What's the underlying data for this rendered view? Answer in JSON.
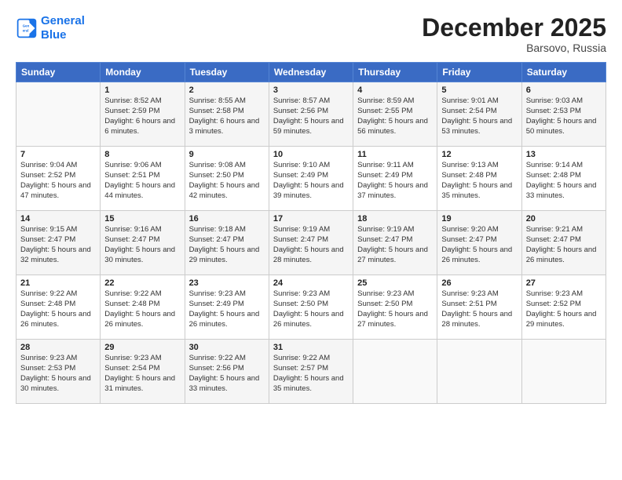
{
  "logo": {
    "line1": "General",
    "line2": "Blue"
  },
  "header": {
    "month": "December 2025",
    "location": "Barsovo, Russia"
  },
  "weekdays": [
    "Sunday",
    "Monday",
    "Tuesday",
    "Wednesday",
    "Thursday",
    "Friday",
    "Saturday"
  ],
  "weeks": [
    [
      {
        "day": "",
        "sunrise": "",
        "sunset": "",
        "daylight": ""
      },
      {
        "day": "1",
        "sunrise": "Sunrise: 8:52 AM",
        "sunset": "Sunset: 2:59 PM",
        "daylight": "Daylight: 6 hours and 6 minutes."
      },
      {
        "day": "2",
        "sunrise": "Sunrise: 8:55 AM",
        "sunset": "Sunset: 2:58 PM",
        "daylight": "Daylight: 6 hours and 3 minutes."
      },
      {
        "day": "3",
        "sunrise": "Sunrise: 8:57 AM",
        "sunset": "Sunset: 2:56 PM",
        "daylight": "Daylight: 5 hours and 59 minutes."
      },
      {
        "day": "4",
        "sunrise": "Sunrise: 8:59 AM",
        "sunset": "Sunset: 2:55 PM",
        "daylight": "Daylight: 5 hours and 56 minutes."
      },
      {
        "day": "5",
        "sunrise": "Sunrise: 9:01 AM",
        "sunset": "Sunset: 2:54 PM",
        "daylight": "Daylight: 5 hours and 53 minutes."
      },
      {
        "day": "6",
        "sunrise": "Sunrise: 9:03 AM",
        "sunset": "Sunset: 2:53 PM",
        "daylight": "Daylight: 5 hours and 50 minutes."
      }
    ],
    [
      {
        "day": "7",
        "sunrise": "Sunrise: 9:04 AM",
        "sunset": "Sunset: 2:52 PM",
        "daylight": "Daylight: 5 hours and 47 minutes."
      },
      {
        "day": "8",
        "sunrise": "Sunrise: 9:06 AM",
        "sunset": "Sunset: 2:51 PM",
        "daylight": "Daylight: 5 hours and 44 minutes."
      },
      {
        "day": "9",
        "sunrise": "Sunrise: 9:08 AM",
        "sunset": "Sunset: 2:50 PM",
        "daylight": "Daylight: 5 hours and 42 minutes."
      },
      {
        "day": "10",
        "sunrise": "Sunrise: 9:10 AM",
        "sunset": "Sunset: 2:49 PM",
        "daylight": "Daylight: 5 hours and 39 minutes."
      },
      {
        "day": "11",
        "sunrise": "Sunrise: 9:11 AM",
        "sunset": "Sunset: 2:49 PM",
        "daylight": "Daylight: 5 hours and 37 minutes."
      },
      {
        "day": "12",
        "sunrise": "Sunrise: 9:13 AM",
        "sunset": "Sunset: 2:48 PM",
        "daylight": "Daylight: 5 hours and 35 minutes."
      },
      {
        "day": "13",
        "sunrise": "Sunrise: 9:14 AM",
        "sunset": "Sunset: 2:48 PM",
        "daylight": "Daylight: 5 hours and 33 minutes."
      }
    ],
    [
      {
        "day": "14",
        "sunrise": "Sunrise: 9:15 AM",
        "sunset": "Sunset: 2:47 PM",
        "daylight": "Daylight: 5 hours and 32 minutes."
      },
      {
        "day": "15",
        "sunrise": "Sunrise: 9:16 AM",
        "sunset": "Sunset: 2:47 PM",
        "daylight": "Daylight: 5 hours and 30 minutes."
      },
      {
        "day": "16",
        "sunrise": "Sunrise: 9:18 AM",
        "sunset": "Sunset: 2:47 PM",
        "daylight": "Daylight: 5 hours and 29 minutes."
      },
      {
        "day": "17",
        "sunrise": "Sunrise: 9:19 AM",
        "sunset": "Sunset: 2:47 PM",
        "daylight": "Daylight: 5 hours and 28 minutes."
      },
      {
        "day": "18",
        "sunrise": "Sunrise: 9:19 AM",
        "sunset": "Sunset: 2:47 PM",
        "daylight": "Daylight: 5 hours and 27 minutes."
      },
      {
        "day": "19",
        "sunrise": "Sunrise: 9:20 AM",
        "sunset": "Sunset: 2:47 PM",
        "daylight": "Daylight: 5 hours and 26 minutes."
      },
      {
        "day": "20",
        "sunrise": "Sunrise: 9:21 AM",
        "sunset": "Sunset: 2:47 PM",
        "daylight": "Daylight: 5 hours and 26 minutes."
      }
    ],
    [
      {
        "day": "21",
        "sunrise": "Sunrise: 9:22 AM",
        "sunset": "Sunset: 2:48 PM",
        "daylight": "Daylight: 5 hours and 26 minutes."
      },
      {
        "day": "22",
        "sunrise": "Sunrise: 9:22 AM",
        "sunset": "Sunset: 2:48 PM",
        "daylight": "Daylight: 5 hours and 26 minutes."
      },
      {
        "day": "23",
        "sunrise": "Sunrise: 9:23 AM",
        "sunset": "Sunset: 2:49 PM",
        "daylight": "Daylight: 5 hours and 26 minutes."
      },
      {
        "day": "24",
        "sunrise": "Sunrise: 9:23 AM",
        "sunset": "Sunset: 2:50 PM",
        "daylight": "Daylight: 5 hours and 26 minutes."
      },
      {
        "day": "25",
        "sunrise": "Sunrise: 9:23 AM",
        "sunset": "Sunset: 2:50 PM",
        "daylight": "Daylight: 5 hours and 27 minutes."
      },
      {
        "day": "26",
        "sunrise": "Sunrise: 9:23 AM",
        "sunset": "Sunset: 2:51 PM",
        "daylight": "Daylight: 5 hours and 28 minutes."
      },
      {
        "day": "27",
        "sunrise": "Sunrise: 9:23 AM",
        "sunset": "Sunset: 2:52 PM",
        "daylight": "Daylight: 5 hours and 29 minutes."
      }
    ],
    [
      {
        "day": "28",
        "sunrise": "Sunrise: 9:23 AM",
        "sunset": "Sunset: 2:53 PM",
        "daylight": "Daylight: 5 hours and 30 minutes."
      },
      {
        "day": "29",
        "sunrise": "Sunrise: 9:23 AM",
        "sunset": "Sunset: 2:54 PM",
        "daylight": "Daylight: 5 hours and 31 minutes."
      },
      {
        "day": "30",
        "sunrise": "Sunrise: 9:22 AM",
        "sunset": "Sunset: 2:56 PM",
        "daylight": "Daylight: 5 hours and 33 minutes."
      },
      {
        "day": "31",
        "sunrise": "Sunrise: 9:22 AM",
        "sunset": "Sunset: 2:57 PM",
        "daylight": "Daylight: 5 hours and 35 minutes."
      },
      {
        "day": "",
        "sunrise": "",
        "sunset": "",
        "daylight": ""
      },
      {
        "day": "",
        "sunrise": "",
        "sunset": "",
        "daylight": ""
      },
      {
        "day": "",
        "sunrise": "",
        "sunset": "",
        "daylight": ""
      }
    ]
  ]
}
